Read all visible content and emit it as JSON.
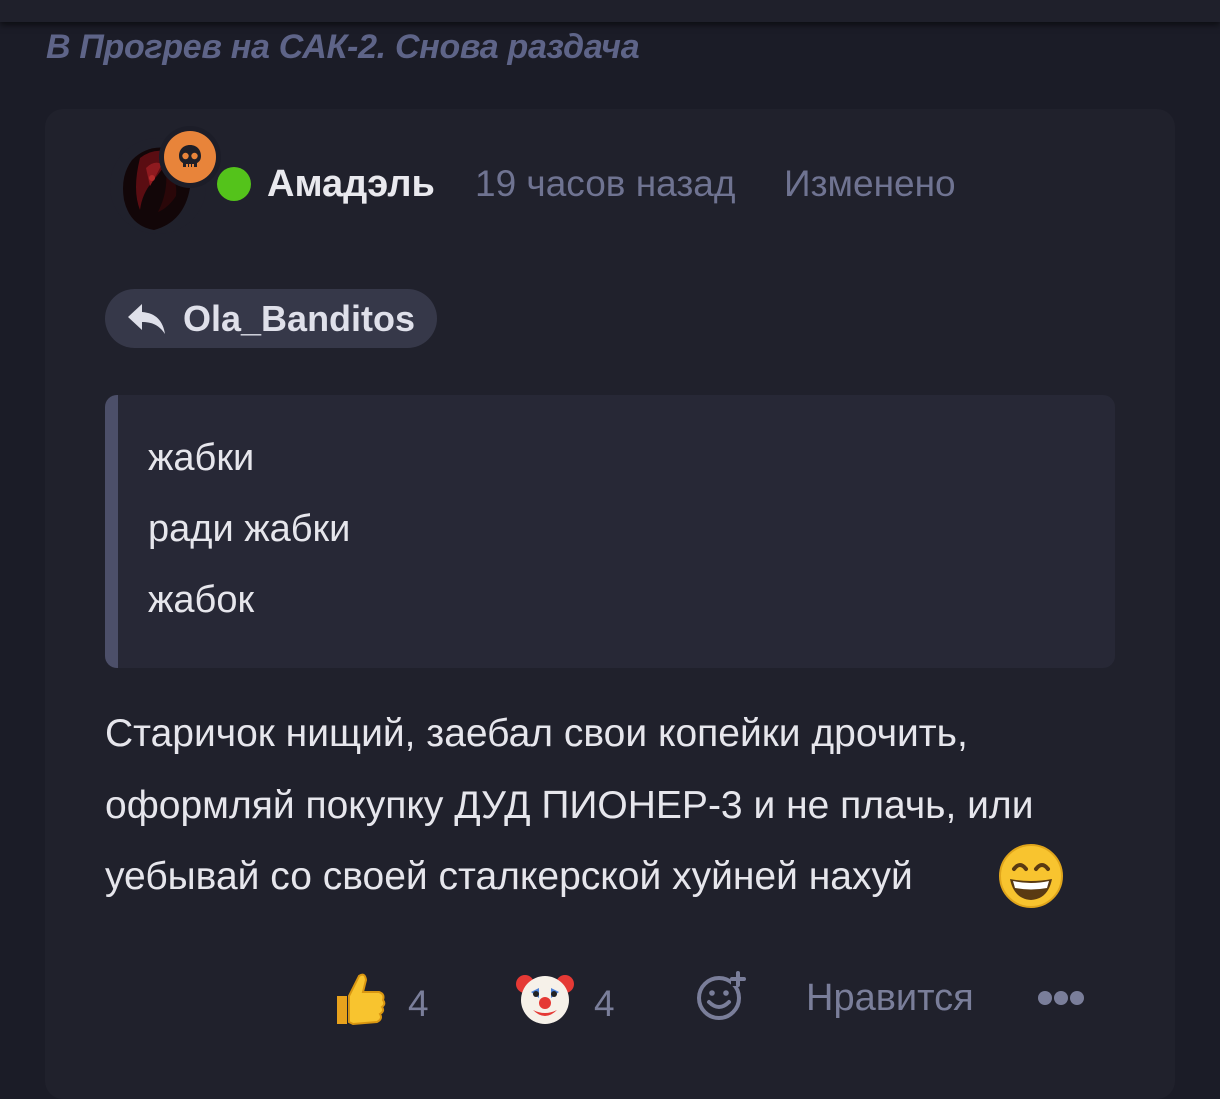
{
  "thread": {
    "title": "В Прогрев на САК-2. Снова раздача"
  },
  "comment": {
    "author": "Амадэль",
    "time_ago": "19 часов назад",
    "edited_label": "Изменено",
    "reply_to": "Ola_Banditos",
    "quote_lines": [
      "жабки",
      "ради жабки",
      "жабок"
    ],
    "body_lines": [
      "Старичок нищий, заебал свои копейки дрочить,",
      "оформляй покупку ДУД ПИОНЕР-3 и не плачь, или",
      "уебывай со своей сталкерской хуйней нахуй"
    ],
    "inline_emoji": "grinning-face-with-smiling-eyes"
  },
  "reactions": {
    "thumbs_up": {
      "icon": "thumbs-up-icon",
      "count": "4"
    },
    "clown": {
      "icon": "clown-face-icon",
      "count": "4"
    },
    "add_reaction_icon": "add-reaction-icon",
    "like_label": "Нравится",
    "more_icon": "more-icon"
  },
  "colors": {
    "background": "#1b1c27",
    "card": "#20212c",
    "online": "#54c31b",
    "badge": "#e8843a",
    "muted_text": "#6f7391"
  }
}
